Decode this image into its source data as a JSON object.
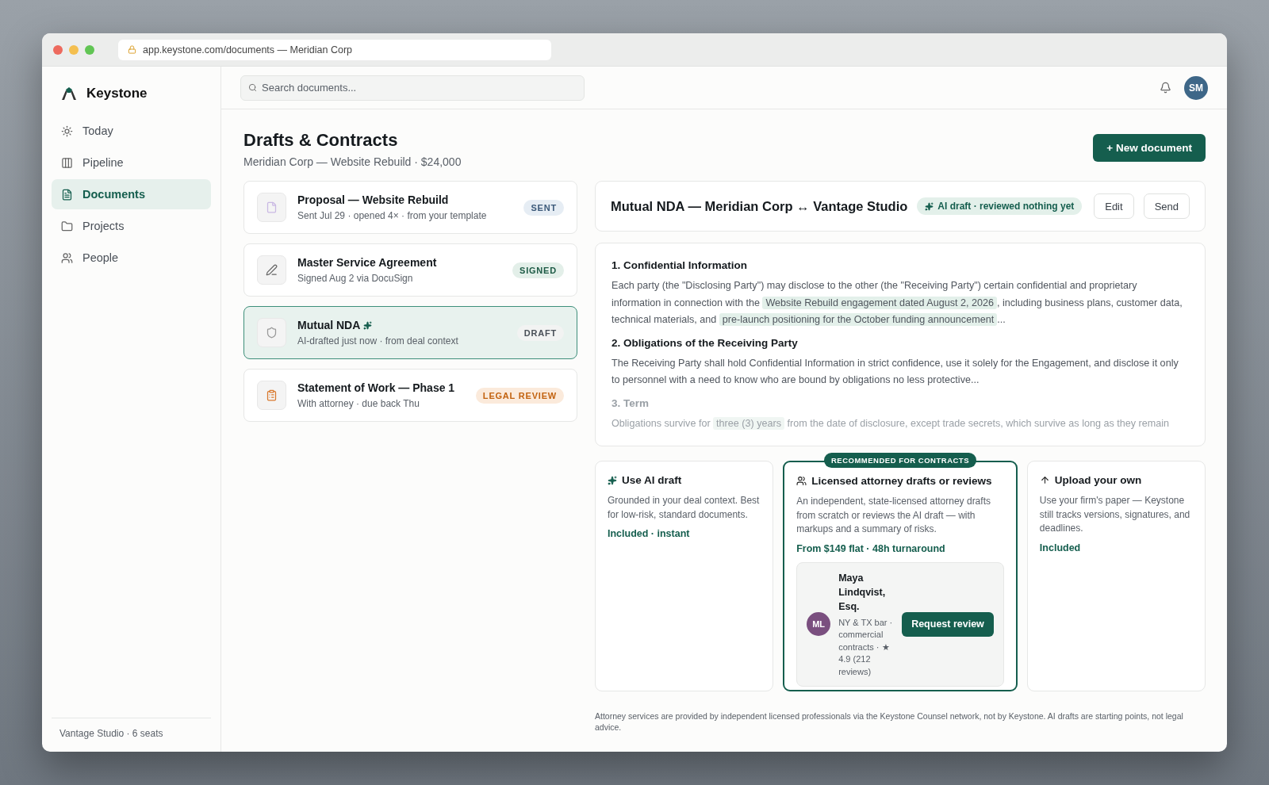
{
  "browser": {
    "address": "app.keystone.com/documents — Meridian Corp"
  },
  "sidebar": {
    "brand": "Keystone",
    "items": [
      {
        "label": "Today",
        "selected": false
      },
      {
        "label": "Pipeline",
        "selected": false
      },
      {
        "label": "Documents",
        "selected": true
      },
      {
        "label": "Projects",
        "selected": false
      },
      {
        "label": "People",
        "selected": false
      }
    ],
    "footer": "Vantage Studio · 6 seats"
  },
  "topbar": {
    "search": {
      "placeholder": "Search documents..."
    },
    "avatar": "SM"
  },
  "page": {
    "title": "Drafts & Contracts",
    "subtitle": "Meridian Corp — Website Rebuild · $24,000",
    "new_button": "+ New document"
  },
  "documents": [
    {
      "title": "Proposal — Website Rebuild",
      "ai": false,
      "meta": "Sent Jul 29 · opened 4× · from your template",
      "status": "SENT",
      "kind": "sent",
      "selected": false
    },
    {
      "title": "Master Service Agreement",
      "ai": false,
      "meta": "Signed Aug 2 via DocuSign",
      "status": "SIGNED",
      "kind": "signed",
      "selected": false
    },
    {
      "title": "Mutual NDA",
      "ai": true,
      "meta": "AI-drafted just now · from deal context",
      "status": "DRAFT",
      "kind": "draft",
      "selected": true
    },
    {
      "title": "Statement of Work — Phase 1",
      "ai": false,
      "meta": "With attorney · due back Thu",
      "status": "LEGAL REVIEW",
      "kind": "review",
      "selected": false
    }
  ],
  "preview": {
    "title": "Mutual NDA — Meridian Corp ↔ Vantage Studio",
    "badge": "AI draft · reviewed nothing yet",
    "buttons": [
      "Edit",
      "Send"
    ],
    "sections": [
      {
        "heading": "1. Confidential Information",
        "faded": false,
        "segments": [
          {
            "text": "Each party (the \"Disclosing Party\") may disclose to the other (the \"Receiving Party\") certain confidential and proprietary information in connection with the ",
            "highlight": false
          },
          {
            "text": "Website Rebuild engagement dated August 2, 2026",
            "highlight": true
          },
          {
            "text": ", including business plans, customer data, technical materials, and ",
            "highlight": false
          },
          {
            "text": "pre-launch positioning for the October funding announcement",
            "highlight": true
          },
          {
            "text": "...",
            "highlight": false
          }
        ]
      },
      {
        "heading": "2. Obligations of the Receiving Party",
        "faded": false,
        "segments": [
          {
            "text": "The Receiving Party shall hold Confidential Information in strict confidence, use it solely for the Engagement, and disclose it only to personnel with a need to know who are bound by obligations no less protective...",
            "highlight": false
          }
        ]
      },
      {
        "heading": "3. Term",
        "faded": true,
        "segments": [
          {
            "text": "Obligations survive for ",
            "highlight": false
          },
          {
            "text": "three (3) years",
            "highlight": true
          },
          {
            "text": " from the date of disclosure, except trade secrets, which survive as long as they remain",
            "highlight": false
          }
        ]
      }
    ]
  },
  "options": [
    {
      "kind": "ai",
      "title": "Use AI draft",
      "description": "Grounded in your deal context. Best for low-risk, standard documents.",
      "price": "Included · instant",
      "recommended": false
    },
    {
      "kind": "attorney",
      "title": "Licensed attorney drafts or reviews",
      "description": "An independent, state-licensed attorney drafts from scratch or reviews the AI draft — with markups and a summary of risks.",
      "price": "From $149 flat · 48h turnaround",
      "recommended": true,
      "ribbon": "RECOMMENDED FOR CONTRACTS",
      "attorney": {
        "initials": "ML",
        "name": "Maya Lindqvist, Esq.",
        "details": "NY & TX bar · commercial contracts · ★ 4.9 (212 reviews)",
        "button": "Request review"
      }
    },
    {
      "kind": "upload",
      "title": "Upload your own",
      "description": "Use your firm's paper — Keystone still tracks versions, signatures, and deadlines.",
      "price": "Included",
      "recommended": false
    }
  ],
  "disclaimer": "Attorney services are provided by independent licensed professionals via the Keystone Counsel network, not by Keystone. AI drafts are starting points, not legal advice."
}
